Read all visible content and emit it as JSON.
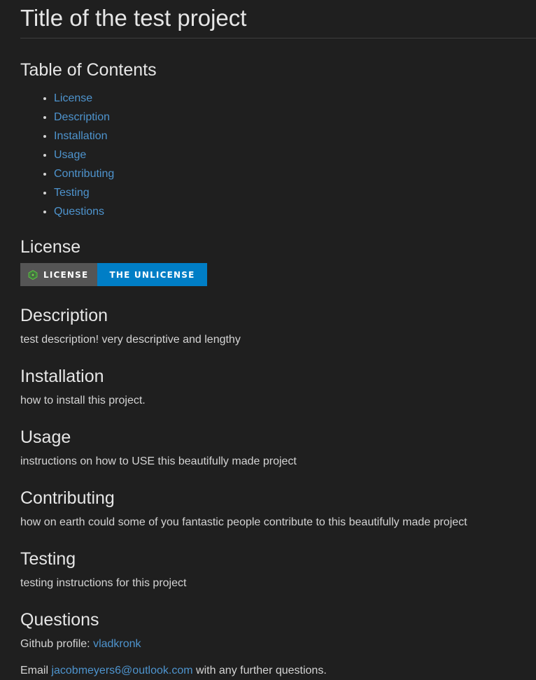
{
  "title": "Title of the test project",
  "toc": {
    "heading": "Table of Contents",
    "items": [
      "License",
      "Description",
      "Installation",
      "Usage",
      "Contributing",
      "Testing",
      "Questions"
    ]
  },
  "license": {
    "heading": "License",
    "badge_left": "LICENSE",
    "badge_right": "THE UNLICENSE",
    "badge_logo": "license-logo-icon",
    "colors": {
      "left": "#555555",
      "right": "#007ec6"
    }
  },
  "description": {
    "heading": "Description",
    "text": "test description! very descriptive and lengthy"
  },
  "installation": {
    "heading": "Installation",
    "text": "how to install this project."
  },
  "usage": {
    "heading": "Usage",
    "text": "instructions on how to USE this beautifully made project"
  },
  "contributing": {
    "heading": "Contributing",
    "text": "how on earth could some of you fantastic people contribute to this beautifully made project"
  },
  "testing": {
    "heading": "Testing",
    "text": "testing instructions for this project"
  },
  "questions": {
    "heading": "Questions",
    "github_label": "Github profile: ",
    "github_user": "vladkronk",
    "email_prefix": "Email ",
    "email": "jacobmeyers6@outlook.com",
    "email_suffix": " with any further questions."
  },
  "colors": {
    "background": "#1f1f1f",
    "text": "#d4d4d4",
    "link": "#4e94ce"
  }
}
